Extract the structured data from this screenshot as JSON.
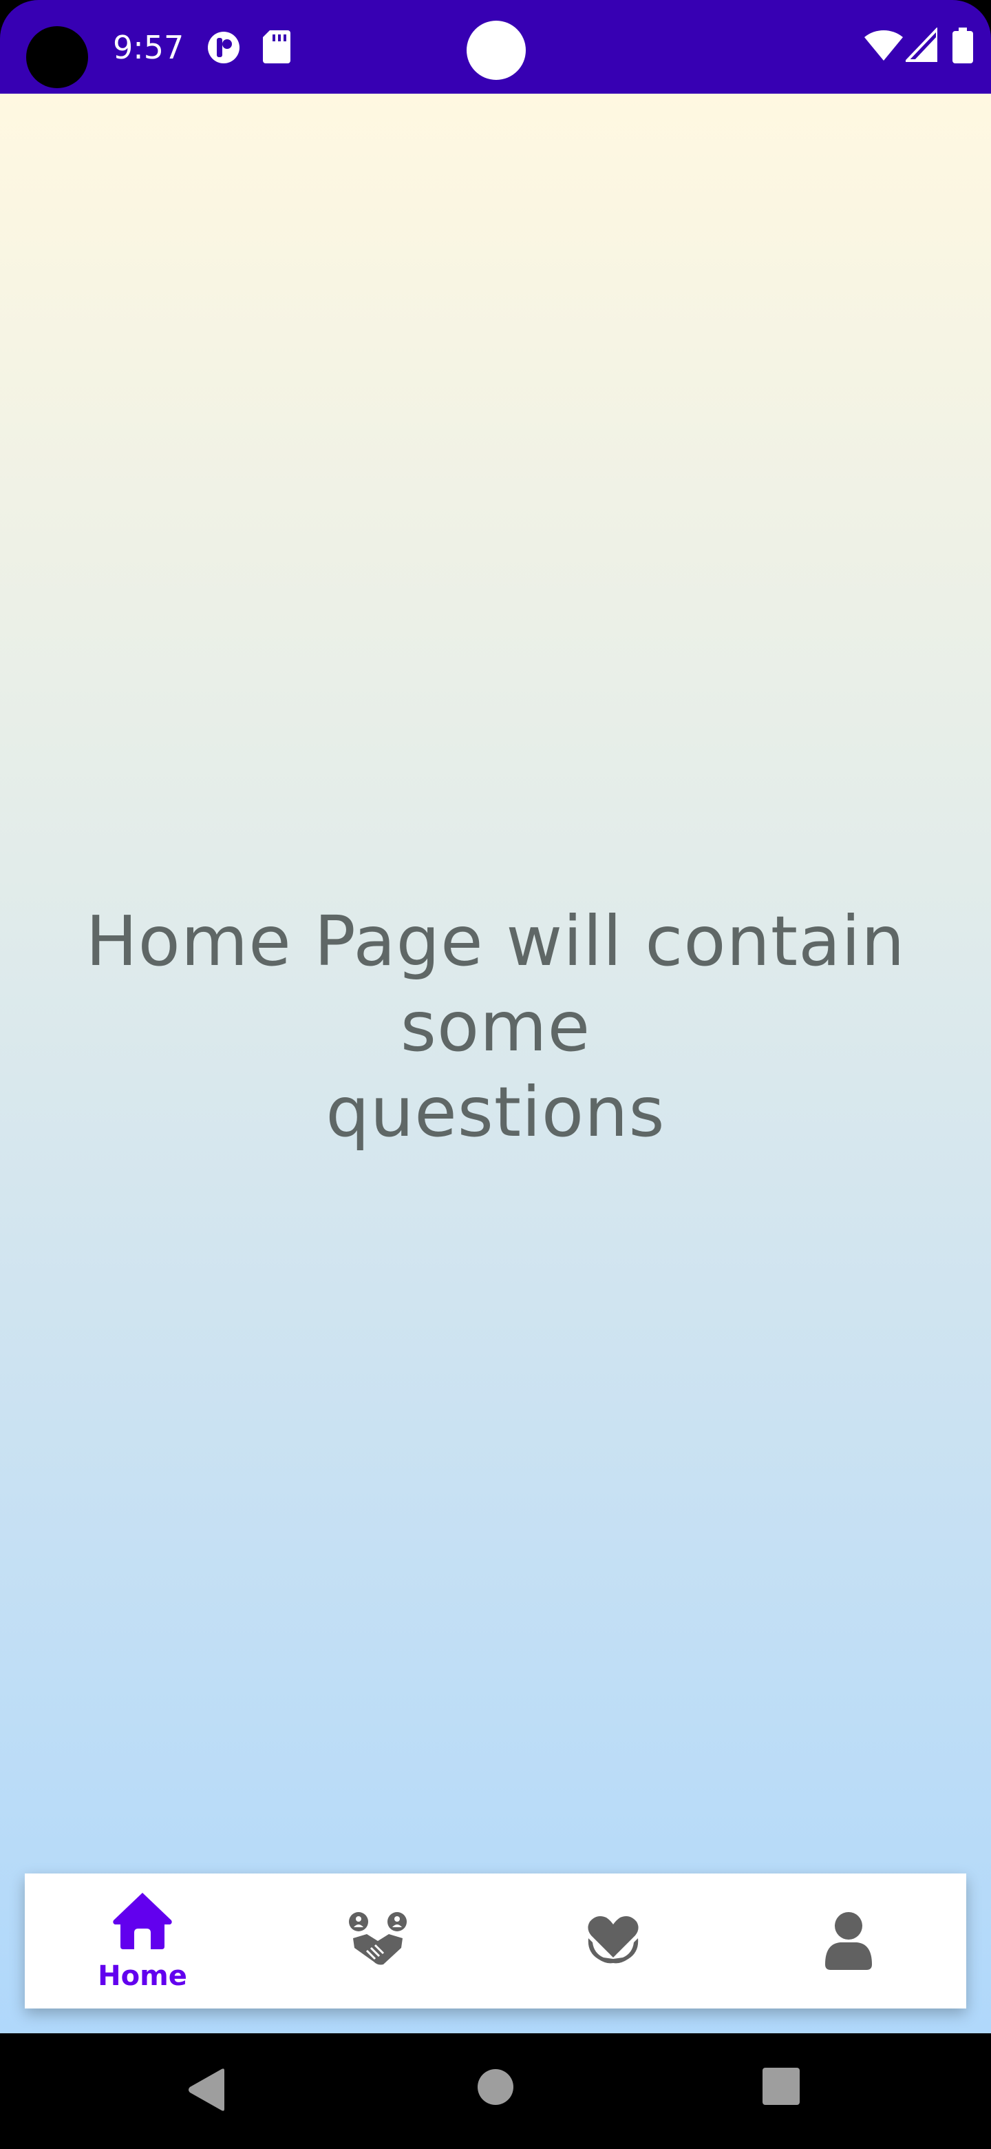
{
  "status_bar": {
    "time": "9:57",
    "icons": [
      "camera-cutout",
      "app-notification-icon",
      "sd-card-icon",
      "center-dot",
      "wifi-icon",
      "signal-icon",
      "battery-icon"
    ],
    "background_color": "#3700b3"
  },
  "main": {
    "headline_line1": "Home Page will contain some",
    "headline_line2": "questions",
    "gradient_colors": [
      "#fff8e1",
      "#e2ecea",
      "#d0e4f0",
      "#b0d8fb"
    ]
  },
  "bottom_nav": {
    "items": [
      {
        "label": "Home",
        "icon": "home-icon",
        "selected": true
      },
      {
        "label": "",
        "icon": "handshake-icon",
        "selected": false
      },
      {
        "label": "",
        "icon": "heart-hands-icon",
        "selected": false
      },
      {
        "label": "",
        "icon": "person-icon",
        "selected": false
      }
    ],
    "selected_color": "#6200ee",
    "unselected_color": "#616161"
  },
  "system_nav": {
    "buttons": [
      "back-icon",
      "home-circle-icon",
      "recents-icon"
    ]
  }
}
